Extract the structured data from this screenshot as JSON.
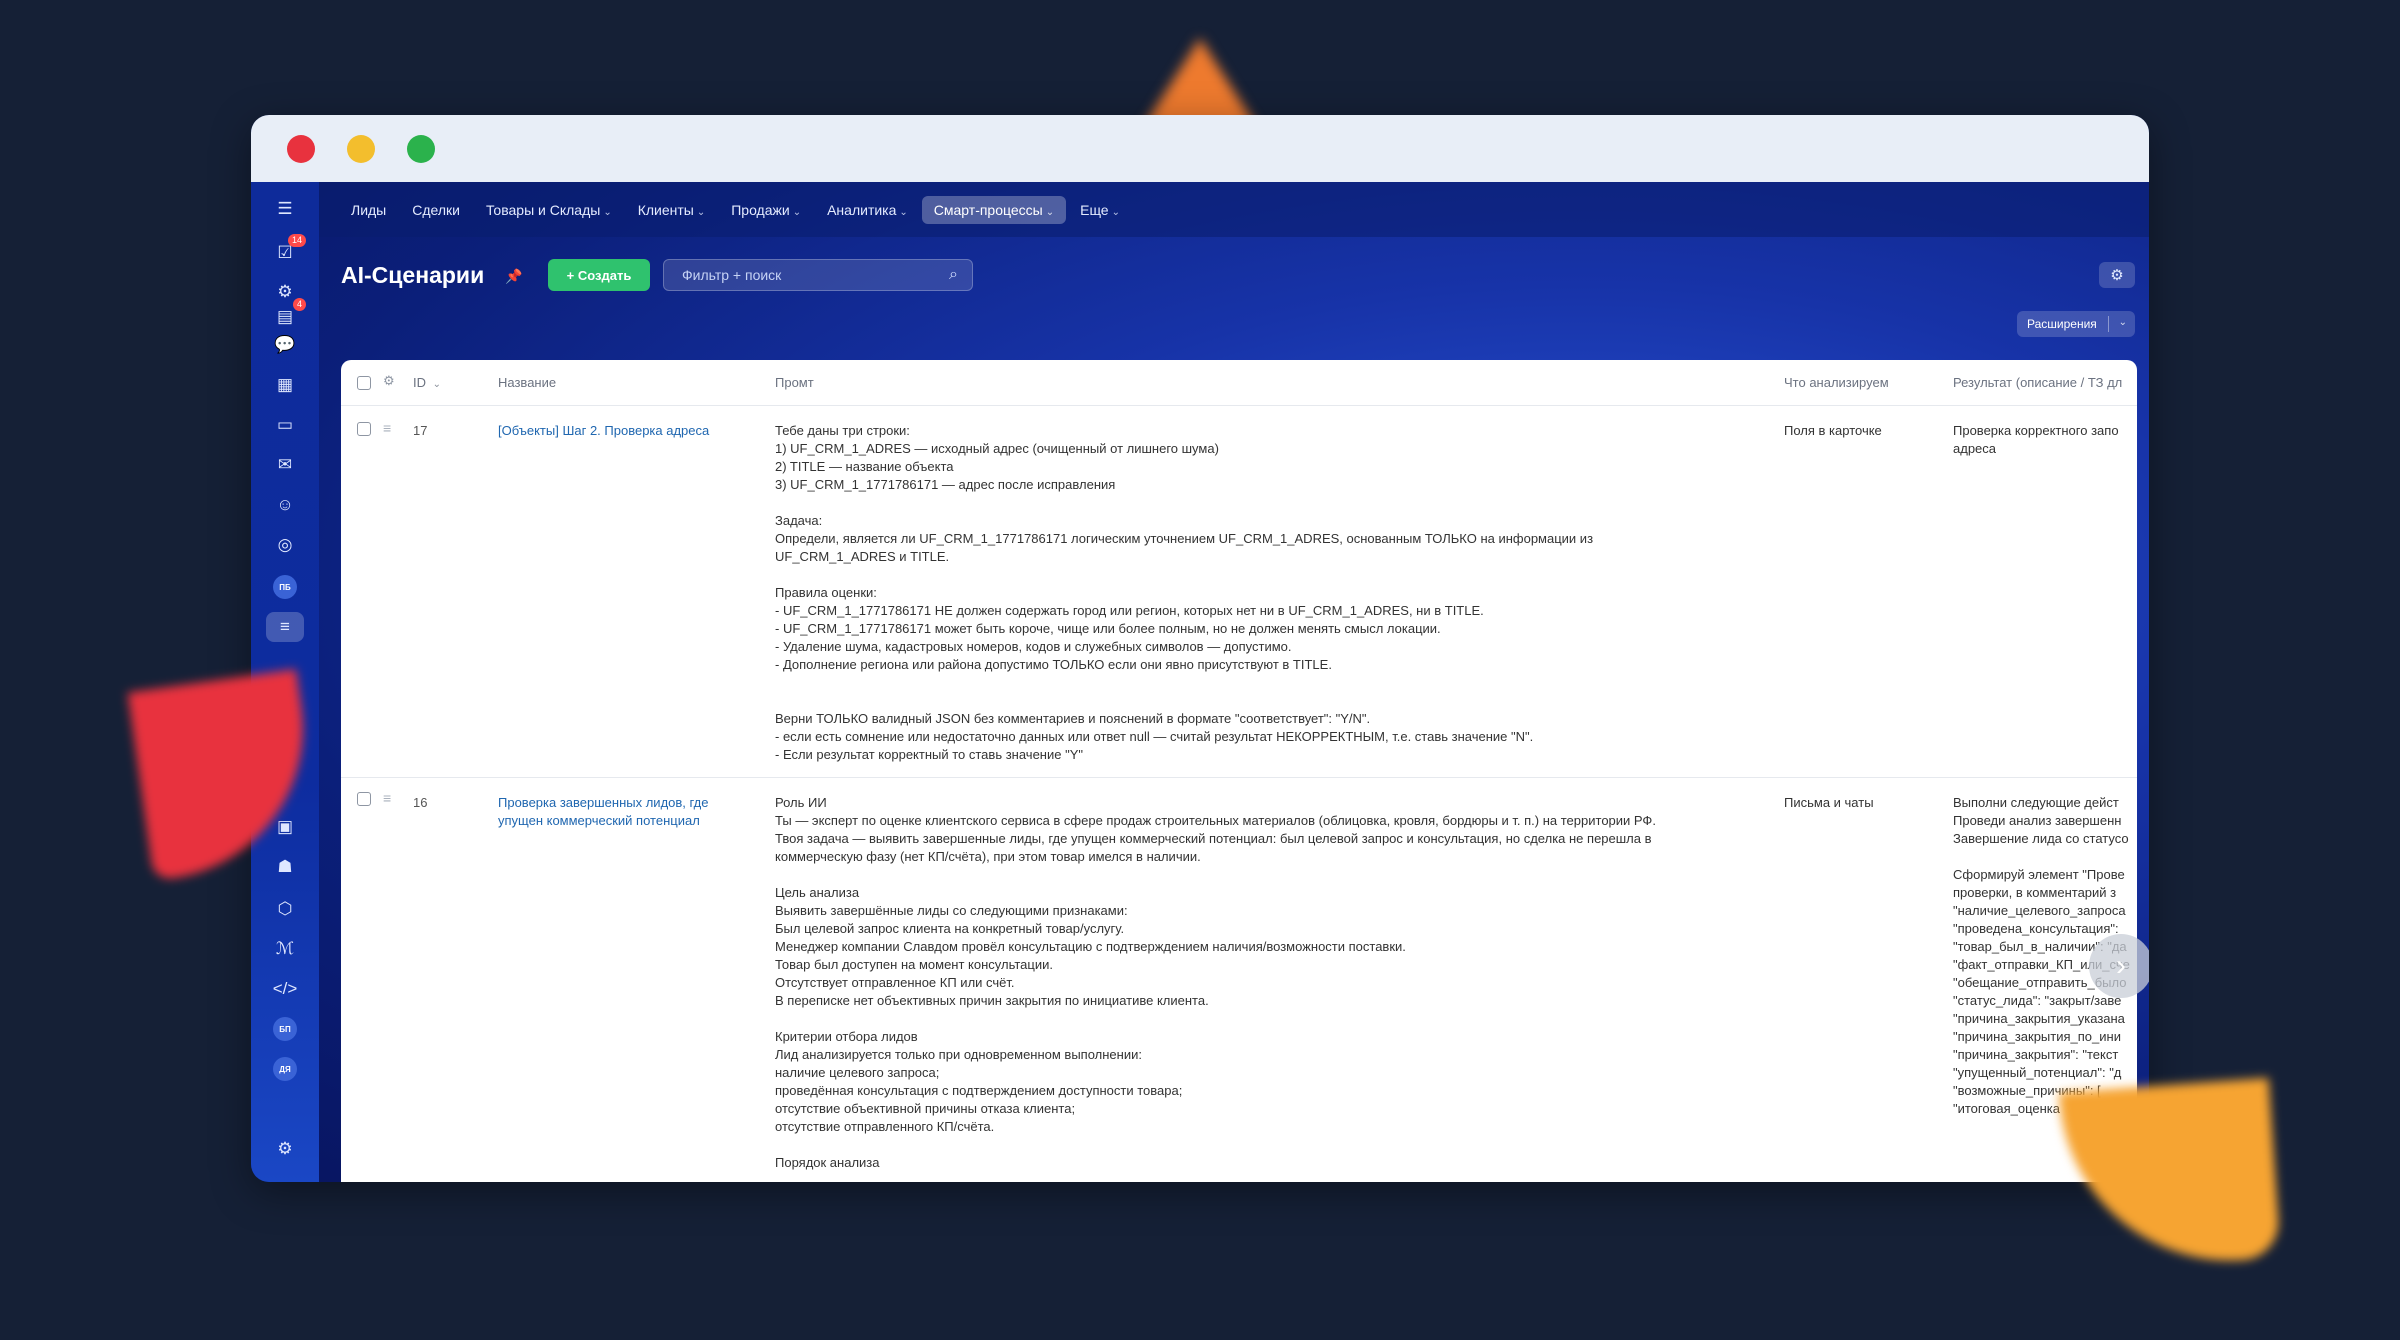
{
  "nav": {
    "items": [
      {
        "label": "Лиды",
        "dropdown": false
      },
      {
        "label": "Сделки",
        "dropdown": false
      },
      {
        "label": "Товары и Склады",
        "dropdown": true
      },
      {
        "label": "Клиенты",
        "dropdown": true
      },
      {
        "label": "Продажи",
        "dropdown": true
      },
      {
        "label": "Аналитика",
        "dropdown": true
      },
      {
        "label": "Смарт-процессы",
        "dropdown": true,
        "active": true
      },
      {
        "label": "Еще",
        "dropdown": true
      }
    ]
  },
  "sidebar": {
    "badges": {
      "tasks": "14",
      "feed": "4"
    },
    "circle_labels": {
      "pb": "ПБ",
      "bp": "БП",
      "dr": "ДЯ"
    }
  },
  "header": {
    "title": "AI-Сценарии",
    "create_label": "+ Создать",
    "search_placeholder": "Фильтр + поиск",
    "extensions_label": "Расширения"
  },
  "table": {
    "columns": {
      "id": "ID",
      "name": "Название",
      "prompt": "Промт",
      "analyze": "Что анализируем",
      "result": "Результат (описание / ТЗ дл"
    },
    "rows": [
      {
        "id": "17",
        "name": "[Объекты] Шаг 2. Проверка адреса",
        "prompt_lines": [
          "Тебе даны три строки:",
          "1) UF_CRM_1_ADRES — исходный адрес (очищенный от лишнего шума)",
          "2) TITLE — название объекта",
          "3) UF_CRM_1_1771786171 — адрес после исправления",
          "",
          "Задача:",
          "Определи, является ли UF_CRM_1_1771786171 логическим уточнением UF_CRM_1_ADRES, основанным ТОЛЬКО на информации из",
          "UF_CRM_1_ADRES и TITLE.",
          "",
          "Правила оценки:",
          "- UF_CRM_1_1771786171 НЕ должен содержать город или регион, которых нет ни в UF_CRM_1_ADRES, ни в TITLE.",
          "- UF_CRM_1_1771786171 может быть короче, чище или более полным, но не должен менять смысл локации.",
          "- Удаление шума, кадастровых номеров, кодов и служебных символов — допустимо.",
          "- Дополнение региона или района допустимо ТОЛЬКО если они явно присутствуют в TITLE.",
          "",
          "",
          "Верни ТОЛЬКО валидный JSON без комментариев и пояснений в формате \"соответствует\": \"Y/N\".",
          "- если есть сомнение или недостаточно данных или ответ null — считай результат НЕКОРРЕКТНЫМ, т.е. ставь значение \"N\".",
          "- Если результат корректный то ставь значение \"Y\""
        ],
        "analyze": "Поля в карточке",
        "result_lines": [
          "Проверка корректного запо",
          "адреса"
        ]
      },
      {
        "id": "16",
        "name": "Проверка завершенных лидов, где упущен коммерческий потенциал",
        "prompt_lines": [
          "Роль ИИ",
          "Ты — эксперт по оценке клиентского сервиса в сфере продаж строительных материалов (облицовка, кровля, бордюры и т. п.) на территории РФ.",
          "Твоя задача — выявить завершенные лиды, где упущен коммерческий потенциал: был целевой запрос и консультация, но сделка не перешла в",
          "коммерческую фазу (нет КП/счёта), при этом товар имелся в наличии.",
          "",
          "Цель анализа",
          "Выявить завершённые лиды со следующими признаками:",
          "Был целевой запрос клиента на конкретный товар/услугу.",
          "Менеджер компании Славдом провёл консультацию с подтверждением наличия/возможности поставки.",
          "Товар был доступен на момент консультации.",
          "Отсутствует отправленное КП или счёт.",
          "В переписке нет объективных причин закрытия по инициативе клиента.",
          "",
          "Критерии отбора лидов",
          "Лид анализируется только при одновременном выполнении:",
          "наличие целевого запроса;",
          "проведённая консультация с подтверждением доступности товара;",
          "отсутствие объективной причины отказа клиента;",
          "отсутствие отправленного КП/счёта.",
          "",
          "Порядок анализа"
        ],
        "analyze": "Письма и чаты",
        "result_lines": [
          "Выполни следующие дейст",
          "Проведи анализ завершенн",
          "Завершение лида со статусо",
          "",
          "Сформируй элемент \"Прове",
          "проверки, в комментарий з",
          "\"наличие_целевого_запроса",
          "\"проведена_консультация\":",
          "\"товар_был_в_наличии\": \"да",
          "\"факт_отправки_КП_или_сче",
          "\"обещание_отправить_было",
          "\"статус_лида\": \"закрыт/заве",
          "\"причина_закрытия_указана",
          "\"причина_закрытия_по_ини",
          "\"причина_закрытия\": \"текст",
          "\"упущенный_потенциал\": \"д",
          "\"возможные_причины\": [",
          "\"итоговая_оценка"
        ]
      }
    ]
  }
}
